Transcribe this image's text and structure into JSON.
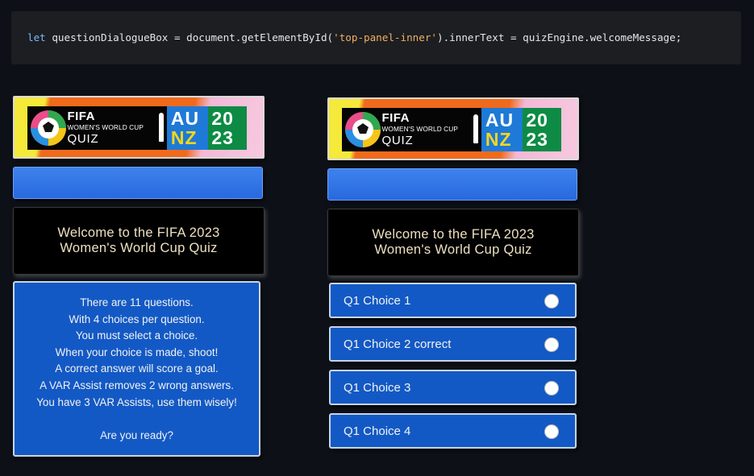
{
  "code": {
    "kw": "let",
    "part1": " questionDialogueBox = document.getElementById(",
    "str": "'top-panel-inner'",
    "part2": ").innerText = quizEngine.welcomeMessage;"
  },
  "banner": {
    "title": "FIFA",
    "subtitle": "WOMEN'S WORLD CUP",
    "quiz": "QUIZ",
    "au": "AU",
    "nz": "NZ",
    "yr_top": "20",
    "yr_bottom": "23"
  },
  "left_panel": {
    "welcome_line1": "Welcome to the FIFA 2023",
    "welcome_line2": "Women's World Cup Quiz",
    "rules": [
      "There are 11 questions.",
      "With 4 choices per question.",
      "You must select a choice.",
      "When your choice is made, shoot!",
      "A correct answer will score a goal.",
      "A VAR Assist removes 2 wrong answers.",
      "You have 3 VAR Assists, use them wisely!"
    ],
    "ready": "Are you ready?"
  },
  "right_panel": {
    "welcome_line1": "Welcome to the FIFA 2023",
    "welcome_line2": "Women's World Cup Quiz",
    "choices": [
      "Q1 Choice 1",
      "Q1 Choice 2 correct",
      "Q1 Choice 3",
      "Q1 Choice 4"
    ]
  },
  "colors": {
    "panel_blue": "#1359c5",
    "bar_blue": "#2f74e6",
    "background": "#0d1117"
  }
}
